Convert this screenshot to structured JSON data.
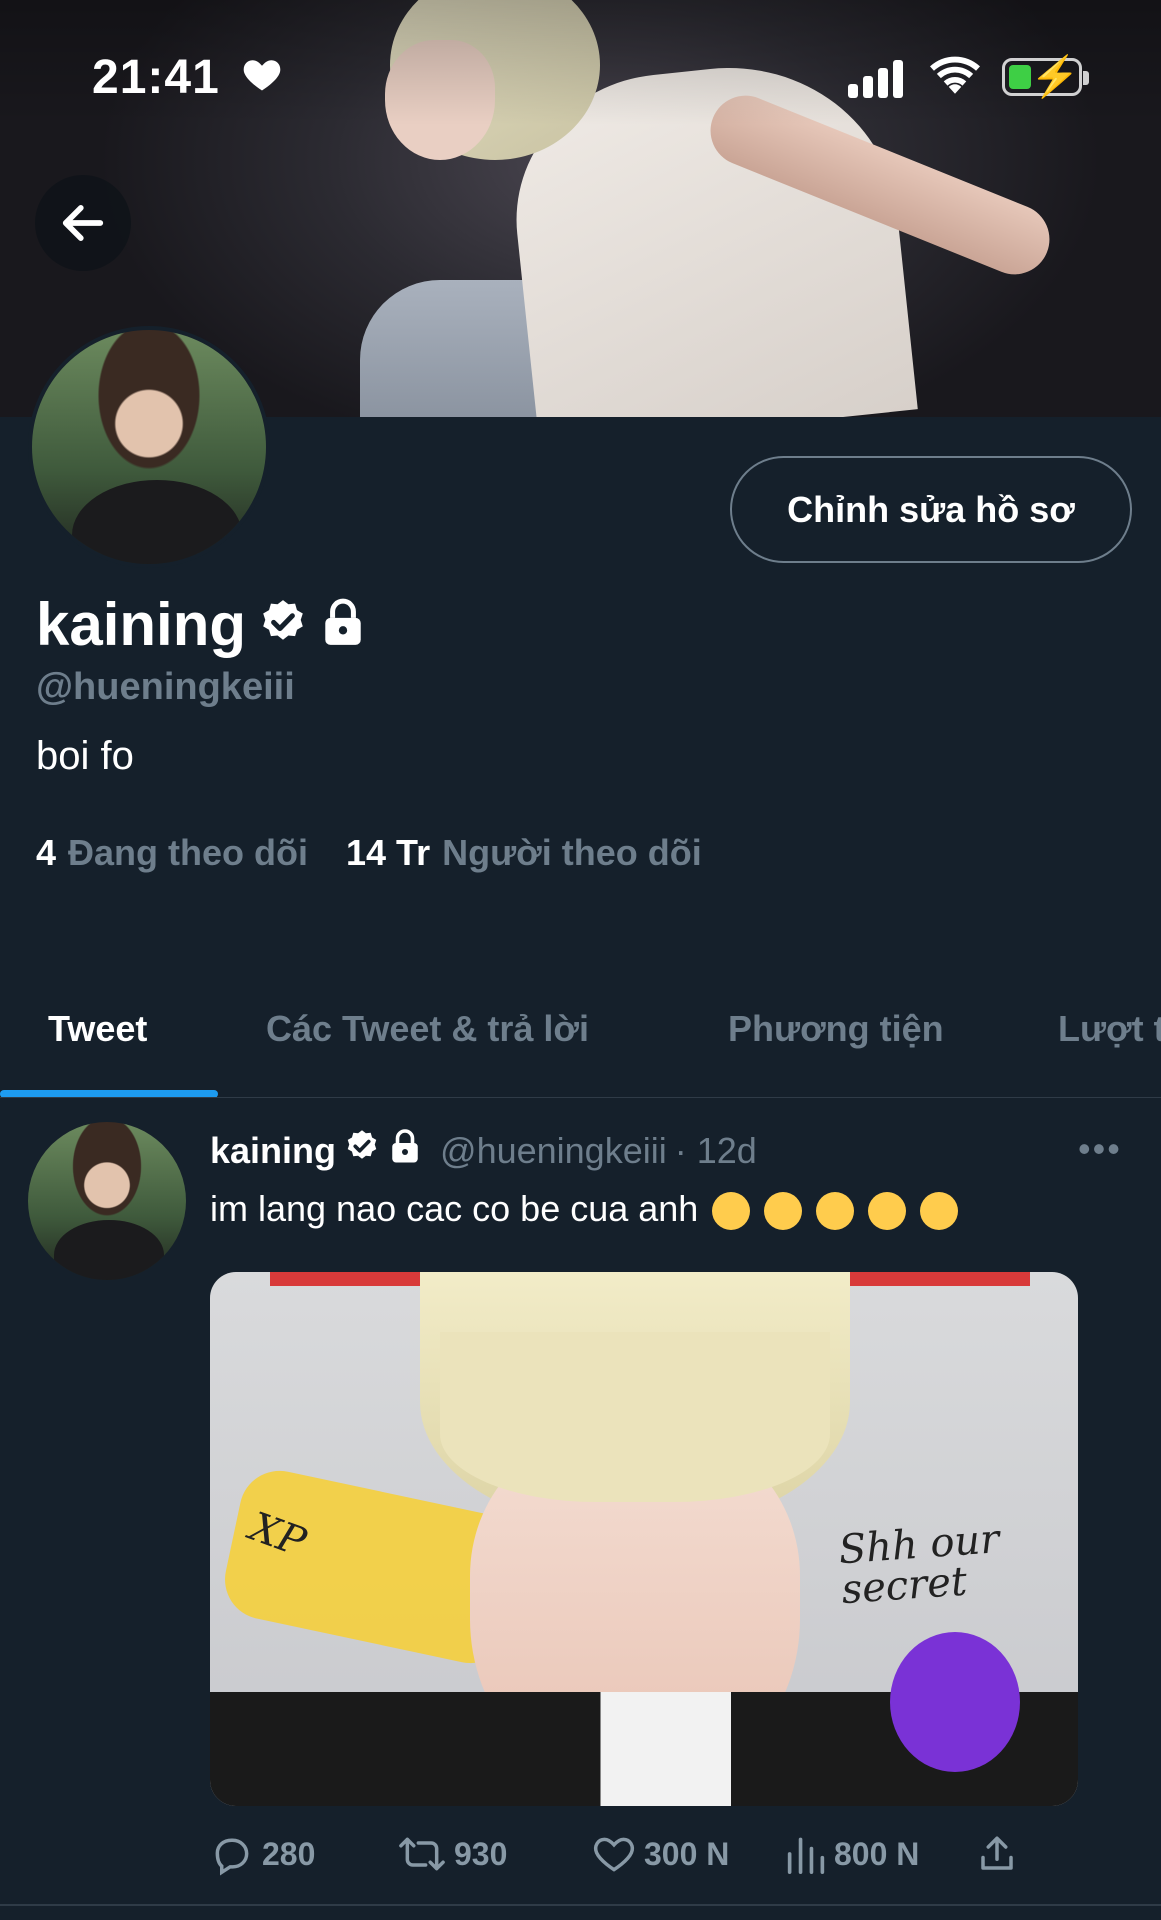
{
  "status_bar": {
    "time": "21:41",
    "heart_icon": "heart-icon"
  },
  "profile": {
    "edit_button_label": "Chỉnh sửa hồ sơ",
    "name": "kaining",
    "handle": "@hueningkeiii",
    "bio": "boi fo",
    "following_count": "4",
    "following_label": "Đang theo dõi",
    "followers_count": "14 Tr",
    "followers_label": "Người theo dõi"
  },
  "tabs": [
    {
      "label": "Tweet"
    },
    {
      "label": "Các Tweet & trả lời"
    },
    {
      "label": "Phương tiện"
    },
    {
      "label": "Lượt t"
    }
  ],
  "tweet": {
    "name": "kaining",
    "handle": "@hueningkeiii",
    "time": "· 12d",
    "text": "im lang nao cac co be cua anh",
    "media_note": "Shh our secret",
    "media_mark": "XP",
    "replies": "280",
    "retweets": "930",
    "likes": "300 N",
    "views": "800 N"
  },
  "colors": {
    "background": "#15202b",
    "muted": "#6e7e8c",
    "accent": "#1d9bf0"
  }
}
